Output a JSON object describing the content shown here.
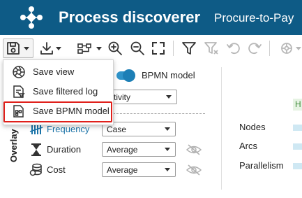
{
  "header": {
    "app_title": "Process discoverer",
    "project_name": "Procure-to-Pay"
  },
  "toolbar": {
    "buttons": [
      {
        "name": "save",
        "icon": "save-icon"
      },
      {
        "name": "download",
        "icon": "download-icon"
      },
      {
        "name": "layout",
        "icon": "layout-icon"
      },
      {
        "name": "zoom-in",
        "icon": "zoom-in-icon"
      },
      {
        "name": "zoom-out",
        "icon": "zoom-out-icon"
      },
      {
        "name": "fit-screen",
        "icon": "fullscreen-icon"
      },
      {
        "name": "filter",
        "icon": "filter-icon"
      },
      {
        "name": "clear-filter",
        "icon": "filter-clear-icon"
      },
      {
        "name": "undo",
        "icon": "undo-icon"
      },
      {
        "name": "redo",
        "icon": "redo-icon"
      },
      {
        "name": "settings",
        "icon": "gear-icon"
      }
    ]
  },
  "save_menu": {
    "items": [
      {
        "label": "Save view",
        "icon": "aperture-icon"
      },
      {
        "label": "Save filtered log",
        "icon": "filtered-log-icon"
      },
      {
        "label": "Save BPMN model",
        "icon": "bpmn-model-icon",
        "highlighted": true
      }
    ]
  },
  "bpmn_toggle": {
    "label": "BPMN model",
    "on": true
  },
  "activity_select": {
    "value": "ctivity"
  },
  "overlay": {
    "label": "Overlay",
    "rows": [
      {
        "label": "Frequency",
        "value": "Case",
        "icon": "frequency-icon",
        "active": true
      },
      {
        "label": "Duration",
        "value": "Average",
        "icon": "hourglass-icon",
        "eye_icon": "eye-off-icon"
      },
      {
        "label": "Cost",
        "value": "Average",
        "icon": "coins-icon",
        "eye_icon": "eye-off-icon"
      }
    ]
  },
  "stats": {
    "badge": "H",
    "rows": [
      {
        "label": "Nodes"
      },
      {
        "label": "Arcs"
      },
      {
        "label": "Parallelism"
      }
    ]
  },
  "colors": {
    "header_bg": "#0e5b86",
    "accent": "#1d7fb6",
    "highlight": "#e0201b",
    "stat_bar": "#cfe8f3"
  }
}
